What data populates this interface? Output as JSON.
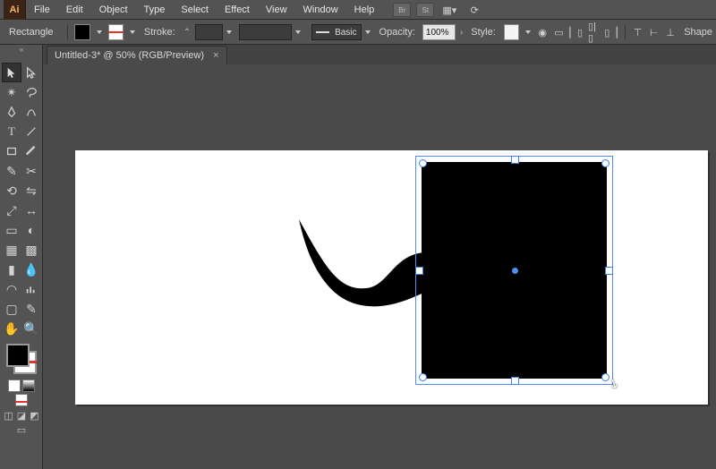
{
  "app": {
    "logo": "Ai"
  },
  "menubar": {
    "items": [
      "File",
      "Edit",
      "Object",
      "Type",
      "Select",
      "Effect",
      "View",
      "Window",
      "Help"
    ],
    "chips": [
      "Br",
      "St"
    ]
  },
  "control": {
    "shape_label": "Rectangle",
    "stroke_label": "Stroke:",
    "brush_style": "Basic",
    "opacity_label": "Opacity:",
    "opacity_value": "100%",
    "style_label": "Style:",
    "shape_tag": "Shape"
  },
  "tab": {
    "title": "Untitled-3* @ 50% (RGB/Preview)"
  },
  "tools": {
    "rows": [
      [
        "selection",
        "direct-selection"
      ],
      [
        "magic-wand",
        "lasso"
      ],
      [
        "pen",
        "curvature"
      ],
      [
        "type",
        "line-segment"
      ],
      [
        "rectangle",
        "paintbrush"
      ],
      [
        "pencil",
        "scissors"
      ],
      [
        "rotate",
        "reflect"
      ],
      [
        "scale",
        "width"
      ],
      [
        "free-transform",
        "shape-builder"
      ],
      [
        "perspective",
        "mesh"
      ],
      [
        "gradient",
        "eyedropper"
      ],
      [
        "blend",
        "column-graph"
      ],
      [
        "artboard",
        "slice"
      ],
      [
        "hand",
        "zoom"
      ]
    ]
  }
}
